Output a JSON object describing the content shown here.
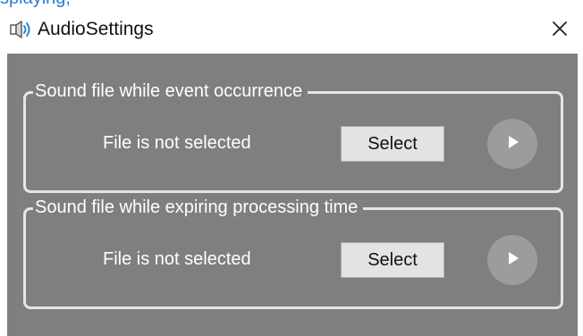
{
  "header": {
    "clipped_link_text": "splaying,",
    "title": "AudioSettings",
    "icon": "speaker-icon",
    "close_icon": "close-icon"
  },
  "groups": [
    {
      "legend": "Sound file while event occurrence",
      "status": "File is not selected",
      "select_label": "Select",
      "play_icon": "play-icon"
    },
    {
      "legend": "Sound file while expiring processing time",
      "status": "File is not selected",
      "select_label": "Select",
      "play_icon": "play-icon"
    }
  ],
  "colors": {
    "panel_background": "#7f7f7f",
    "group_border": "#e6e6e6",
    "button_background": "#e3e3e3",
    "play_button_background": "#9c9c9c",
    "link_color": "#2b7bd6"
  }
}
